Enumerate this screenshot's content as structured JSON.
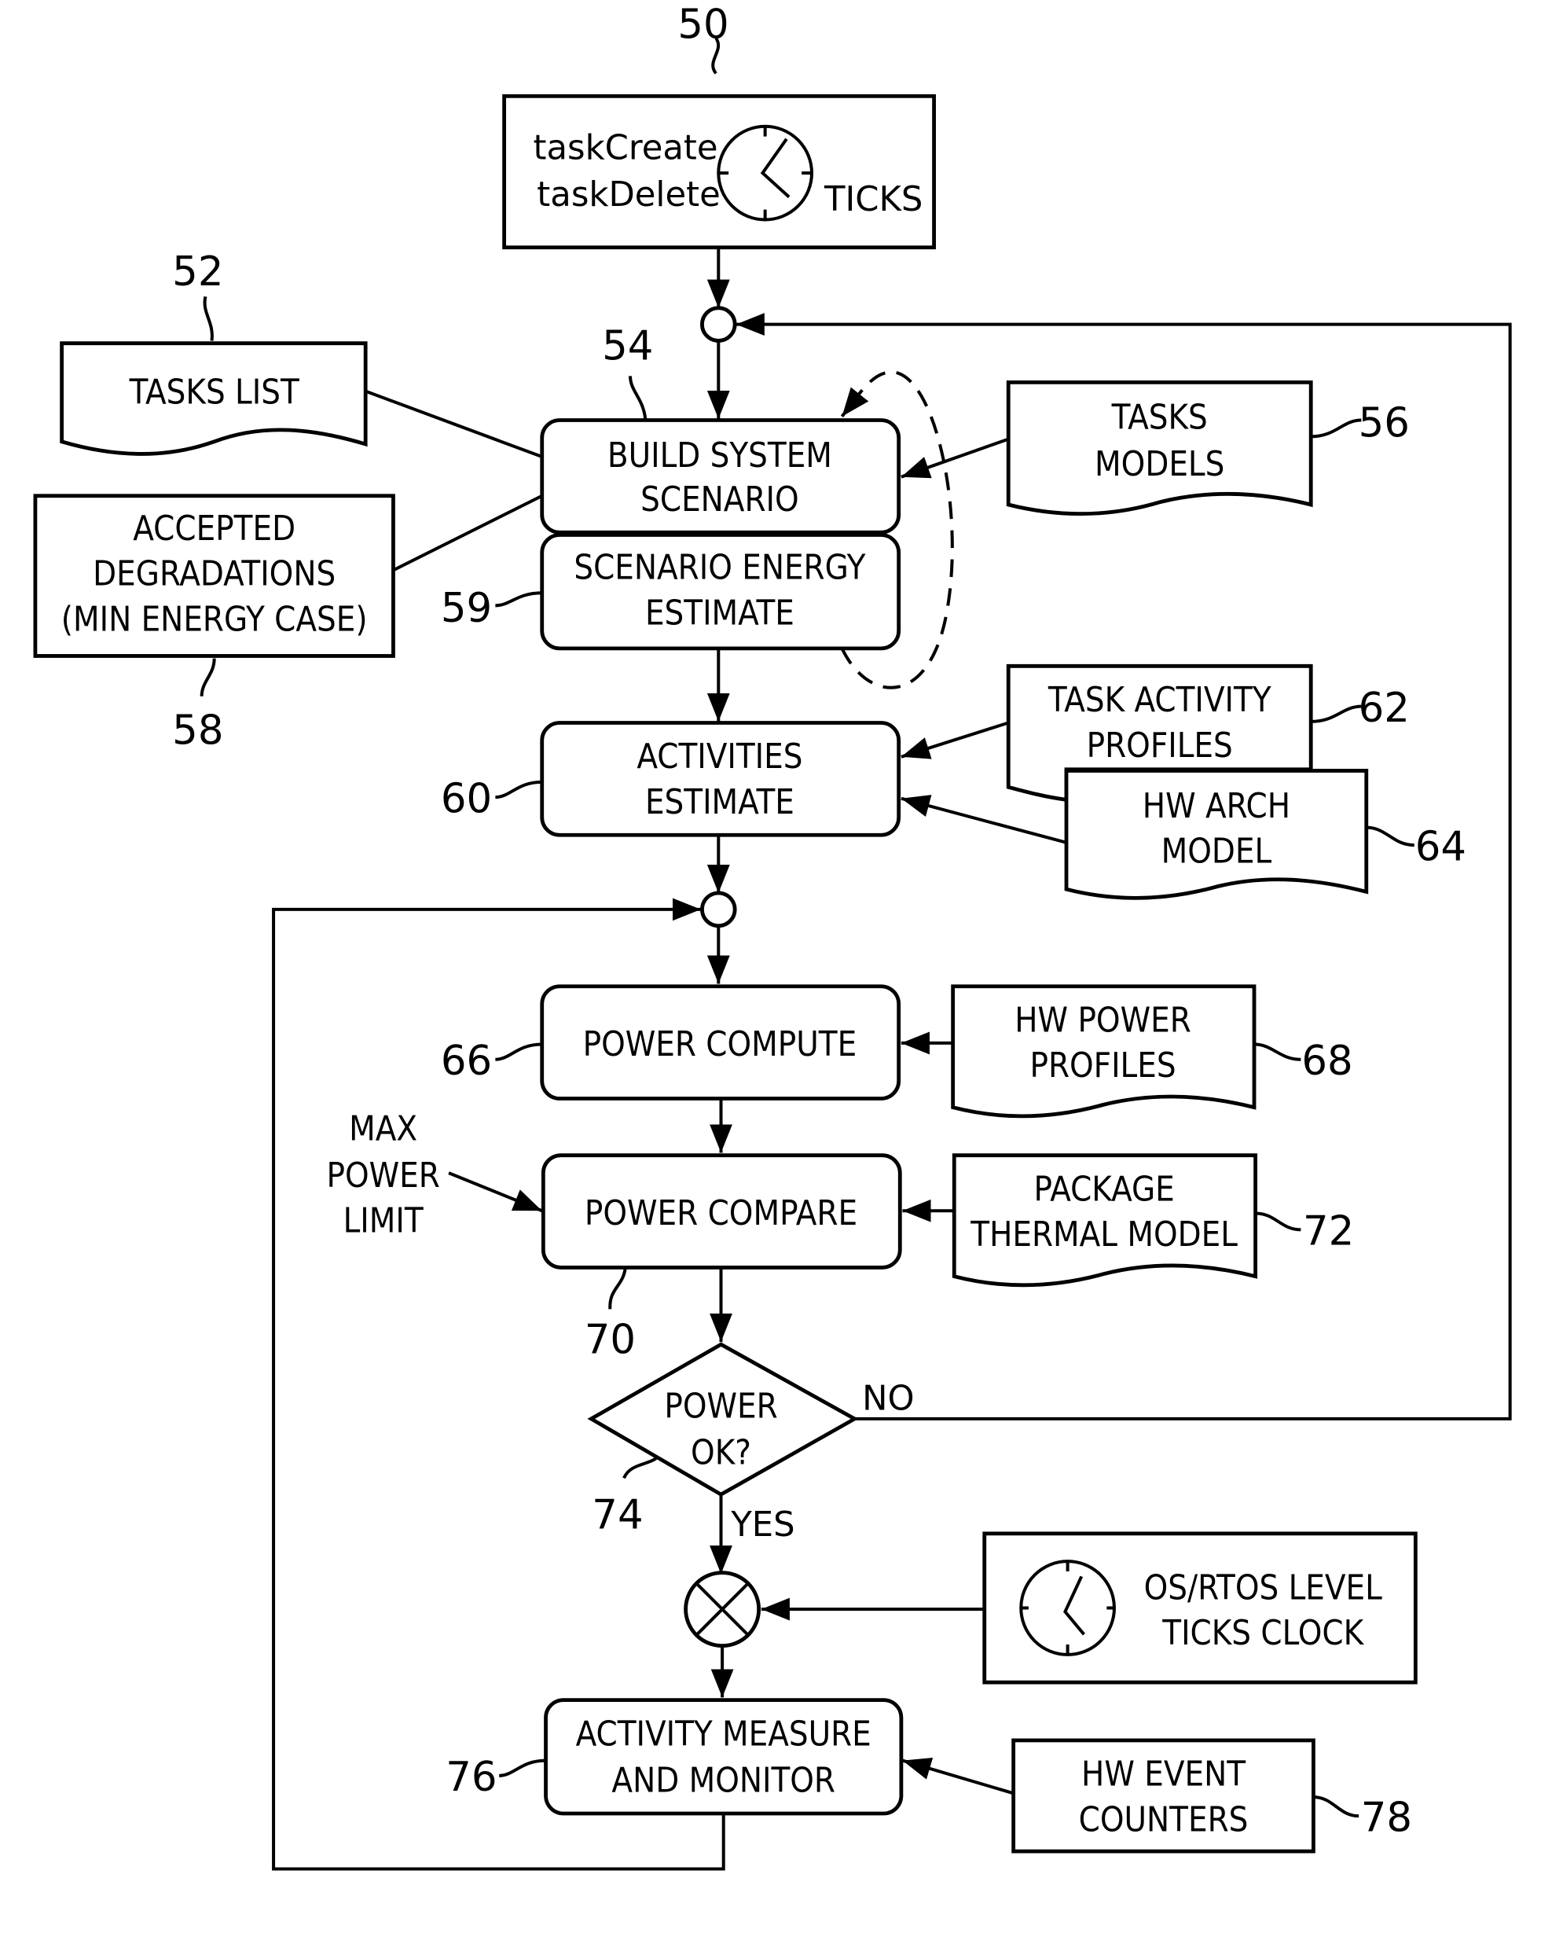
{
  "diagram": {
    "type": "flowchart",
    "nodes": {
      "n50": {
        "ref": "50",
        "lines": [
          "taskCreate",
          "taskDelete"
        ],
        "side_label": "TICKS"
      },
      "n52": {
        "ref": "52",
        "lines": [
          "TASKS LIST"
        ]
      },
      "n54": {
        "ref": "54",
        "lines": [
          "BUILD SYSTEM",
          "SCENARIO"
        ]
      },
      "n56": {
        "ref": "56",
        "lines": [
          "TASKS",
          "MODELS"
        ]
      },
      "n58": {
        "ref": "58",
        "lines": [
          "ACCEPTED",
          "DEGRADATIONS",
          "(MIN ENERGY CASE)"
        ]
      },
      "n59": {
        "ref": "59",
        "lines": [
          "SCENARIO ENERGY",
          "ESTIMATE"
        ]
      },
      "n60": {
        "ref": "60",
        "lines": [
          "ACTIVITIES",
          "ESTIMATE"
        ]
      },
      "n62": {
        "ref": "62",
        "lines": [
          "TASK ACTIVITY",
          "PROFILES"
        ]
      },
      "n64": {
        "ref": "64",
        "lines": [
          "HW ARCH",
          "MODEL"
        ]
      },
      "n66": {
        "ref": "66",
        "lines": [
          "POWER COMPUTE"
        ]
      },
      "n68": {
        "ref": "68",
        "lines": [
          "HW POWER",
          "PROFILES"
        ]
      },
      "n70": {
        "ref": "70",
        "lines": [
          "POWER COMPARE"
        ]
      },
      "n72": {
        "ref": "72",
        "lines": [
          "PACKAGE",
          "THERMAL MODEL"
        ]
      },
      "n74": {
        "ref": "74",
        "lines": [
          "POWER",
          "OK?"
        ]
      },
      "n76": {
        "ref": "76",
        "lines": [
          "ACTIVITY MEASURE",
          "AND MONITOR"
        ]
      },
      "n78": {
        "ref": "78",
        "lines": [
          "HW EVENT",
          "COUNTERS"
        ]
      },
      "clock": {
        "lines": [
          "OS/RTOS LEVEL",
          "TICKS CLOCK"
        ]
      },
      "maxpower": {
        "lines": [
          "MAX",
          "POWER",
          "LIMIT"
        ]
      }
    },
    "edge_labels": {
      "no": "NO",
      "yes": "YES"
    }
  }
}
